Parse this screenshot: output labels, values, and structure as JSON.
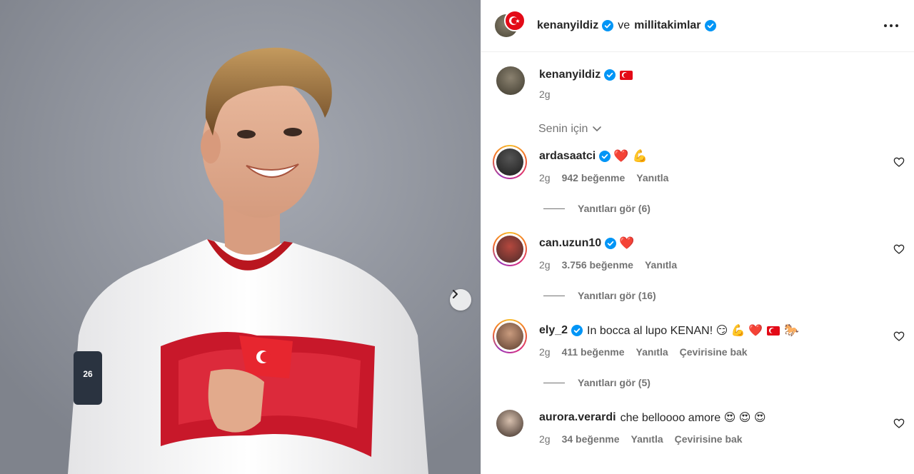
{
  "colors": {
    "accent": "#0095f6",
    "text": "#262626",
    "muted": "#737373",
    "like_red": "#ed4956",
    "flag_red": "#e30a17"
  },
  "header": {
    "author": "kenanyildiz",
    "joiner": "ve",
    "collaborator": "millitakimlar",
    "more_icon": "more-horizontal-icon"
  },
  "caption": {
    "username": "kenanyildiz",
    "time": "2g",
    "emoji": "turkey-flag"
  },
  "filter": {
    "label": "Senin için",
    "icon": "chevron-down-icon"
  },
  "comments": [
    {
      "username": "ardasaatci",
      "verified": true,
      "text": "❤️ 💪",
      "time": "2g",
      "likes": "942 beğenme",
      "reply": "Yanıtla",
      "translate": "",
      "view_replies": "Yanıtları gör (6)"
    },
    {
      "username": "can.uzun10",
      "verified": true,
      "text": "❤️",
      "time": "2g",
      "likes": "3.756 beğenme",
      "reply": "Yanıtla",
      "translate": "",
      "view_replies": "Yanıtları gör (16)"
    },
    {
      "username": "ely_2",
      "verified": true,
      "text": "In bocca al lupo KENAN! 😏 💪 ❤️",
      "text_tail": "🐎",
      "time": "2g",
      "likes": "411 beğenme",
      "reply": "Yanıtla",
      "translate": "Çevirisine bak",
      "view_replies": "Yanıtları gör (5)"
    },
    {
      "username": "aurora.verardi",
      "verified": false,
      "text": "che belloooo amore 😍 😍 😍",
      "time": "2g",
      "likes": "34 beğenme",
      "reply": "Yanıtla",
      "translate": "Çevirisine bak",
      "view_replies": ""
    }
  ],
  "media": {
    "next_icon": "chevron-right-icon"
  }
}
